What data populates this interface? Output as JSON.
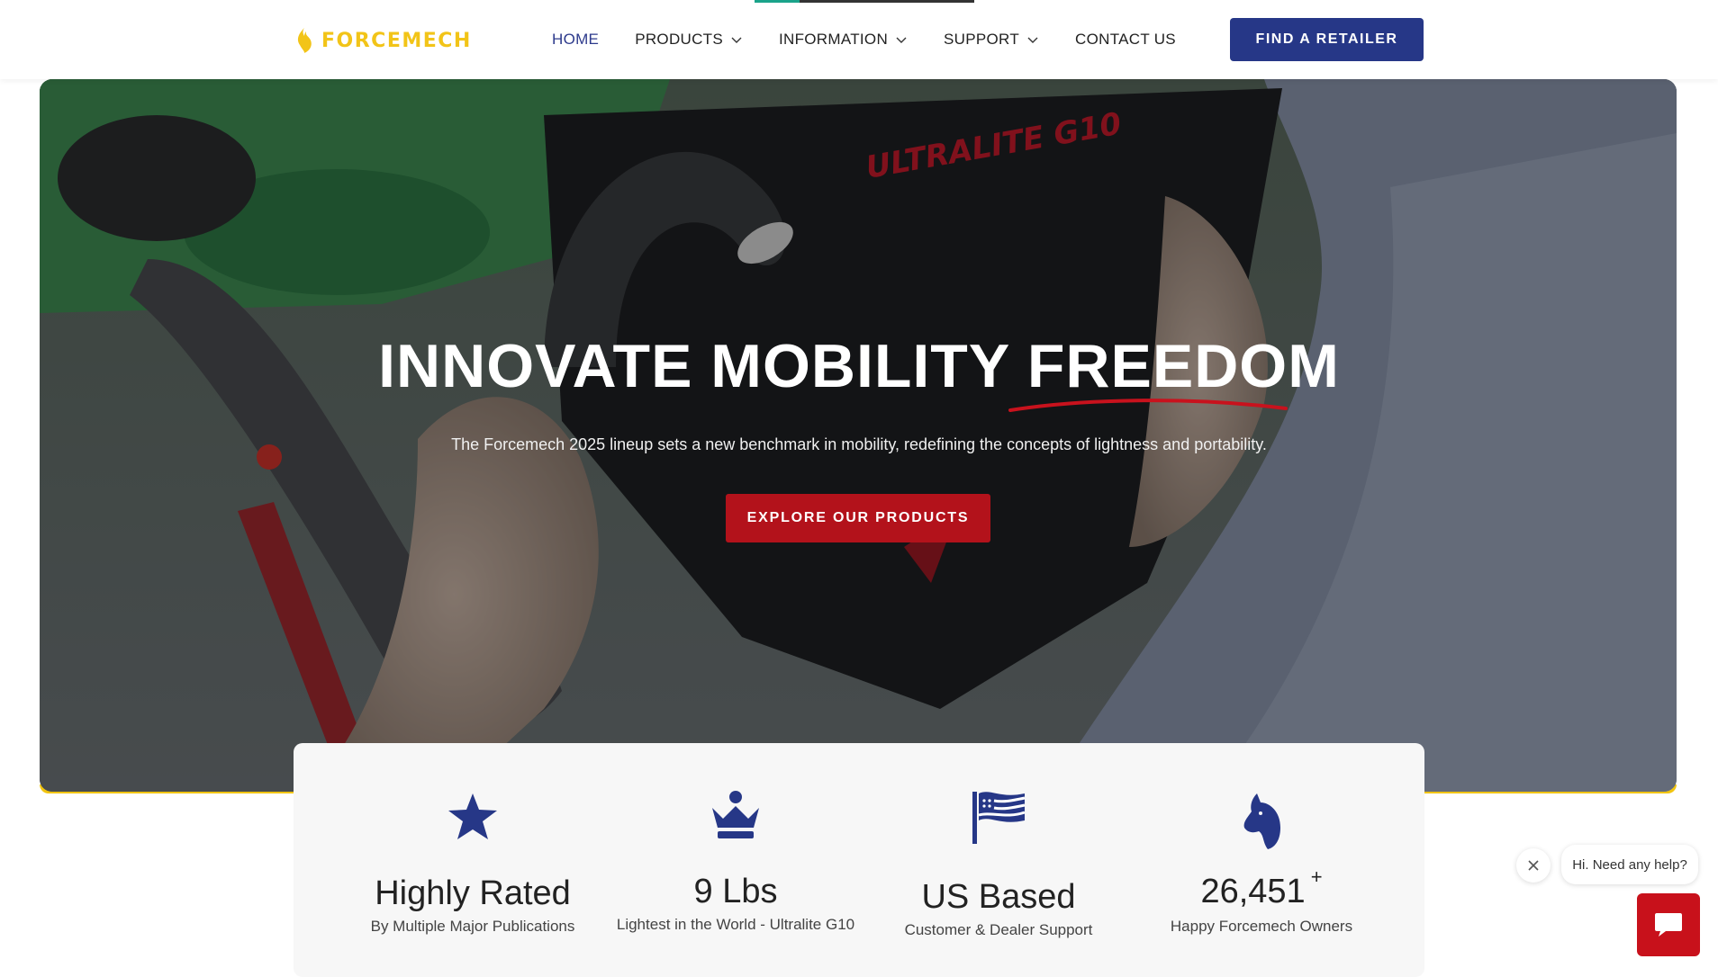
{
  "header": {
    "logo_text": "FORCEMECH",
    "nav": [
      {
        "label": "HOME",
        "has_dropdown": false,
        "active": true
      },
      {
        "label": "PRODUCTS",
        "has_dropdown": true
      },
      {
        "label": "INFORMATION",
        "has_dropdown": true
      },
      {
        "label": "SUPPORT",
        "has_dropdown": true
      },
      {
        "label": "CONTACT US",
        "has_dropdown": false
      }
    ],
    "cta_label": "FIND A RETAILER"
  },
  "hero": {
    "title": "INNOVATE MOBILITY FREEDOM",
    "subtitle": "The Forcemech 2025 lineup sets a new benchmark in mobility, redefining the concepts of lightness and portability.",
    "button_label": "EXPLORE OUR PRODUCTS",
    "image_text": "ULTRALITE G10"
  },
  "stats": [
    {
      "icon": "star-icon",
      "title": "Highly Rated",
      "desc": "By Multiple Major Publications"
    },
    {
      "icon": "crown-icon",
      "title": "9 Lbs",
      "desc": "Lightest in the World - Ultralite G10"
    },
    {
      "icon": "flag-icon",
      "title": "US Based",
      "desc": "Customer & Dealer Support"
    },
    {
      "icon": "horse-head-icon",
      "title": "26,451",
      "title_suffix": "+",
      "desc": "Happy Forcemech Owners"
    }
  ],
  "chat": {
    "bubble_text": "Hi. Need any help?"
  },
  "colors": {
    "brand_blue": "#263787",
    "brand_red": "#b3121b",
    "brand_yellow": "#f1c40f"
  }
}
